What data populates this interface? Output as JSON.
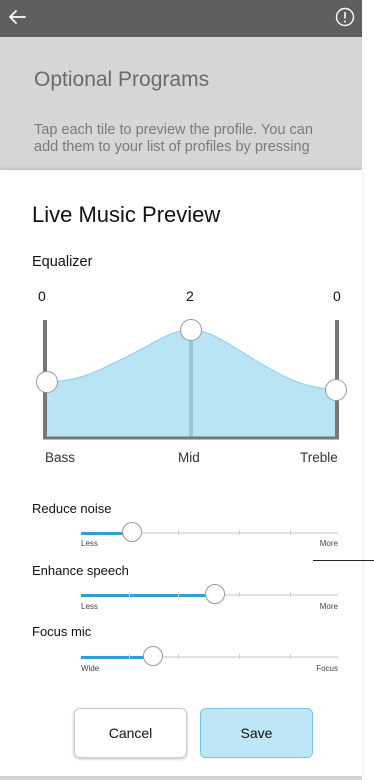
{
  "background": {
    "title": "Optional Programs",
    "description": "Tap each tile to preview the profile. You can add them to your list of profiles by pressing"
  },
  "icons": {
    "back": "arrow-left-icon",
    "info": "info-circle-icon"
  },
  "colors": {
    "accent": "#2f9fd6",
    "eq_fill": "#b9e4f4",
    "save_bg": "#bfe6f6",
    "topbar": "#5e5e5e"
  },
  "modal": {
    "title": "Live Music Preview",
    "equalizer": {
      "label": "Equalizer",
      "bands": [
        {
          "name": "Bass",
          "value": "0"
        },
        {
          "name": "Mid",
          "value": "2"
        },
        {
          "name": "Treble",
          "value": "0"
        }
      ]
    },
    "sliders": [
      {
        "label": "Reduce noise",
        "min_label": "Less",
        "max_label": "More",
        "value": 0.2
      },
      {
        "label": "Enhance speech",
        "min_label": "Less",
        "max_label": "More",
        "value": 0.52
      },
      {
        "label": "Focus mic",
        "min_label": "Wide",
        "max_label": "Focus",
        "value": 0.28
      }
    ],
    "buttons": {
      "cancel": "Cancel",
      "save": "Save"
    }
  }
}
